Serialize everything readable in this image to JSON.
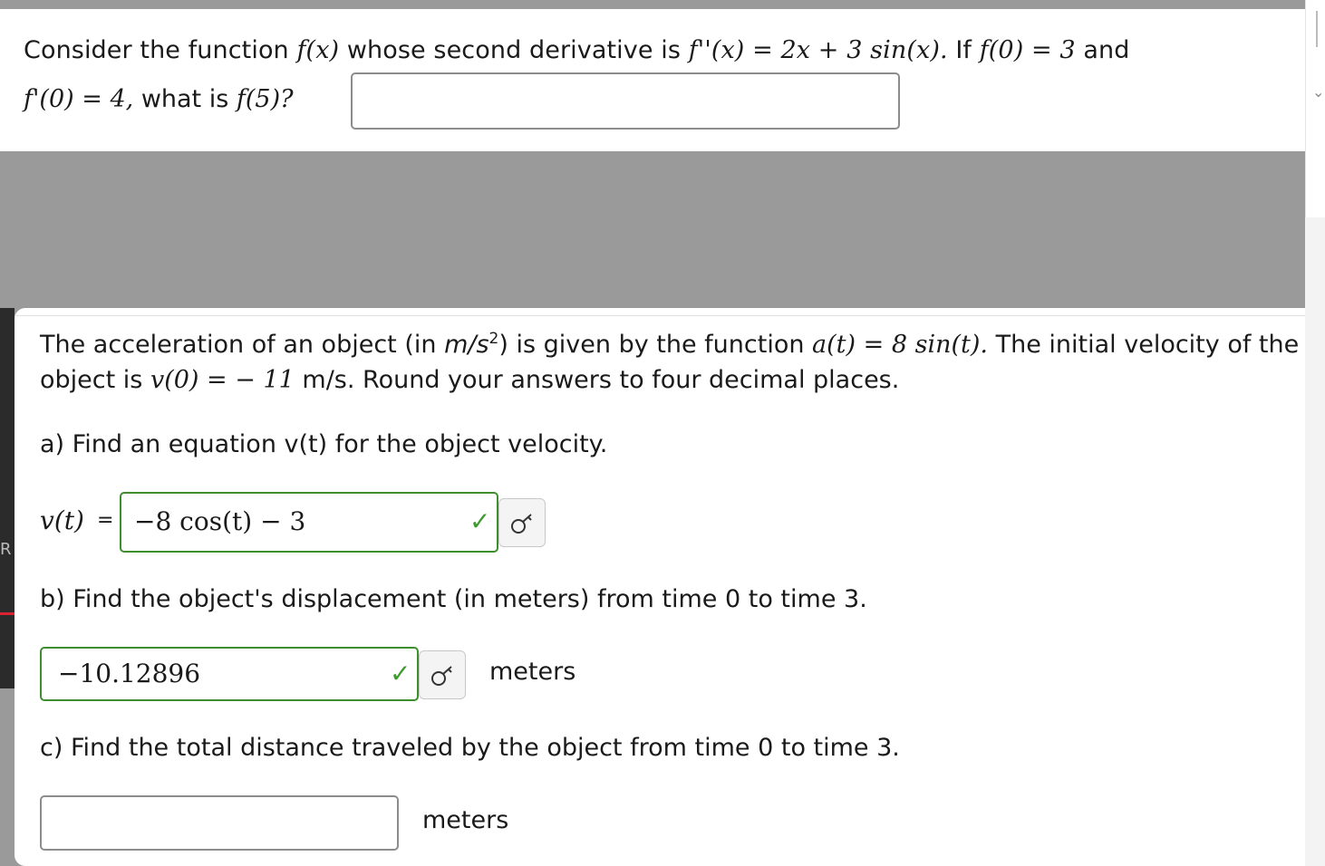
{
  "question1": {
    "line1_prefix": "Consider the function",
    "line1_func": "f(x)",
    "line1_mid": "whose second derivative is",
    "line1_eq": "f''(x) = 2x + 3 sin(x).",
    "line1_if": "If",
    "line1_cond": "f(0) = 3",
    "line1_and": "and",
    "line2_cond": "f'(0) = 4,",
    "line2_ask": "what is",
    "line2_target": "f(5)?",
    "answer_value": ""
  },
  "question2": {
    "intro_a": "The acceleration of an object (in",
    "intro_unit_base": "m/s",
    "intro_unit_exp": "2",
    "intro_b": ") is given by the function",
    "intro_func": "a(t) = 8 sin(t).",
    "intro_c": "The initial velocity of the",
    "intro_d": "object is",
    "intro_v0": "v(0) =  − 11",
    "intro_e": "m/s. Round your answers to four decimal places.",
    "part_a": {
      "prompt": "a) Find an equation v(t) for the object velocity.",
      "label": "v(t)",
      "equals": "=",
      "answer": "−8 cos(t) − 3",
      "status": "correct"
    },
    "part_b": {
      "prompt": "b) Find the object's displacement (in meters) from time 0 to time 3.",
      "answer": "−10.12896",
      "unit": "meters",
      "status": "correct"
    },
    "part_c": {
      "prompt": "c) Find the total distance traveled by the object from time 0 to time 3.",
      "answer": "",
      "unit": "meters"
    }
  },
  "side": {
    "left_letter": "R"
  },
  "colors": {
    "correct": "#3e8e2e",
    "overlay": "#9a9a9a"
  },
  "icons": [
    "check-icon",
    "key-icon",
    "chevron-down-icon"
  ]
}
